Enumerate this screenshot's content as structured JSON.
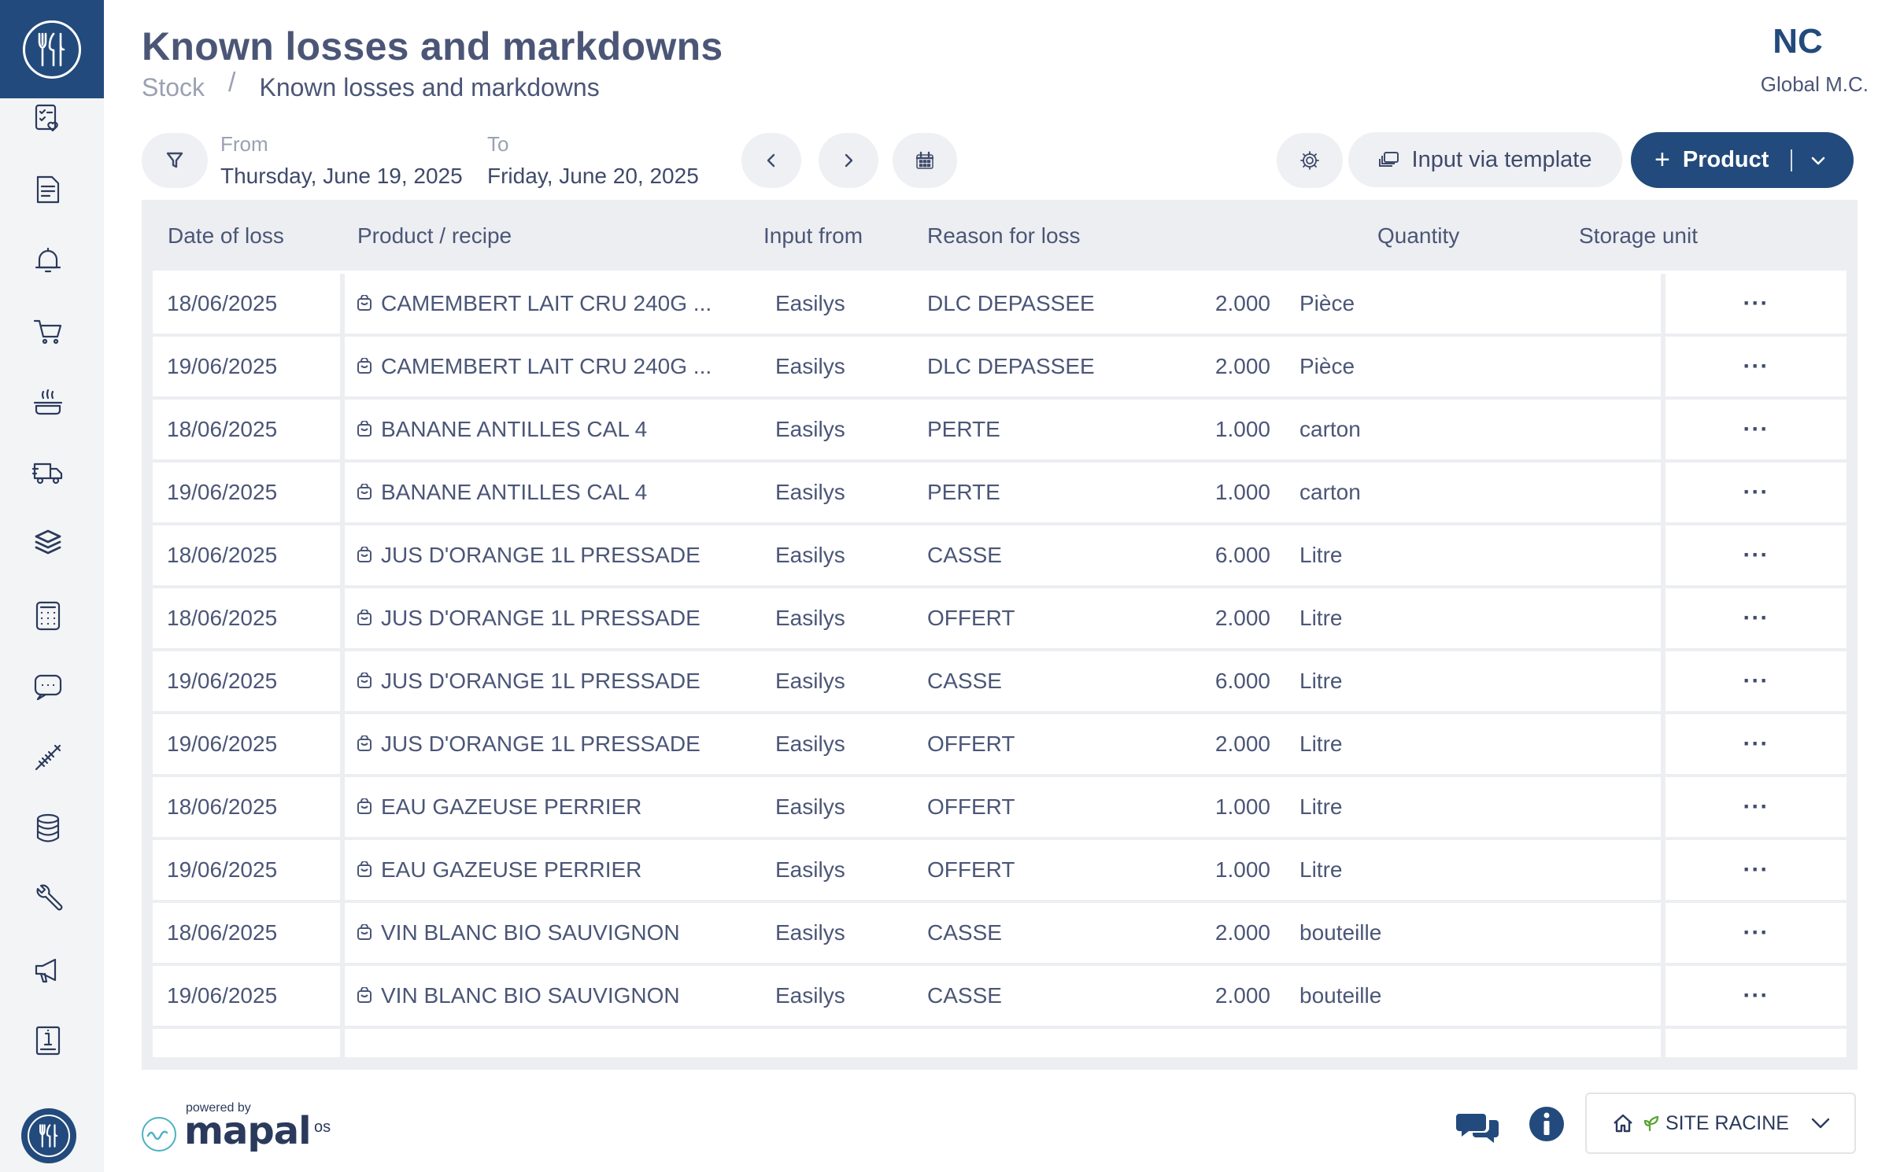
{
  "header": {
    "title": "Known losses and markdowns",
    "breadcrumb": {
      "root": "Stock",
      "separator": "/",
      "current": "Known losses and markdowns"
    },
    "user": {
      "initials": "NC",
      "company": "Global M.C."
    }
  },
  "toolbar": {
    "from_label": "From",
    "from_value": "Thursday, June 19, 2025",
    "to_label": "To",
    "to_value": "Friday, June 20, 2025",
    "template_label": "Input via template",
    "product_plus": "+",
    "product_label": "Product"
  },
  "table": {
    "columns": [
      "Date of loss",
      "Product / recipe",
      "Input from",
      "Reason for loss",
      "Quantity",
      "Storage unit"
    ],
    "row_menu": "···",
    "rows": [
      {
        "date": "18/06/2025",
        "product": "CAMEMBERT LAIT CRU 240G ...",
        "input": "Easilys",
        "reason": "DLC DEPASSEE",
        "qty": "2.000",
        "unit": "Pièce"
      },
      {
        "date": "19/06/2025",
        "product": "CAMEMBERT LAIT CRU 240G ...",
        "input": "Easilys",
        "reason": "DLC DEPASSEE",
        "qty": "2.000",
        "unit": "Pièce"
      },
      {
        "date": "18/06/2025",
        "product": "BANANE ANTILLES CAL 4",
        "input": "Easilys",
        "reason": "PERTE",
        "qty": "1.000",
        "unit": "carton"
      },
      {
        "date": "19/06/2025",
        "product": "BANANE ANTILLES CAL 4",
        "input": "Easilys",
        "reason": "PERTE",
        "qty": "1.000",
        "unit": "carton"
      },
      {
        "date": "18/06/2025",
        "product": "JUS D'ORANGE 1L PRESSADE",
        "input": "Easilys",
        "reason": "CASSE",
        "qty": "6.000",
        "unit": "Litre"
      },
      {
        "date": "18/06/2025",
        "product": "JUS D'ORANGE 1L PRESSADE",
        "input": "Easilys",
        "reason": "OFFERT",
        "qty": "2.000",
        "unit": "Litre"
      },
      {
        "date": "19/06/2025",
        "product": "JUS D'ORANGE 1L PRESSADE",
        "input": "Easilys",
        "reason": "CASSE",
        "qty": "6.000",
        "unit": "Litre"
      },
      {
        "date": "19/06/2025",
        "product": "JUS D'ORANGE 1L PRESSADE",
        "input": "Easilys",
        "reason": "OFFERT",
        "qty": "2.000",
        "unit": "Litre"
      },
      {
        "date": "18/06/2025",
        "product": "EAU GAZEUSE PERRIER",
        "input": "Easilys",
        "reason": "OFFERT",
        "qty": "1.000",
        "unit": "Litre"
      },
      {
        "date": "19/06/2025",
        "product": "EAU GAZEUSE PERRIER",
        "input": "Easilys",
        "reason": "OFFERT",
        "qty": "1.000",
        "unit": "Litre"
      },
      {
        "date": "18/06/2025",
        "product": "VIN BLANC BIO SAUVIGNON",
        "input": "Easilys",
        "reason": "CASSE",
        "qty": "2.000",
        "unit": "bouteille"
      },
      {
        "date": "19/06/2025",
        "product": "VIN BLANC BIO SAUVIGNON",
        "input": "Easilys",
        "reason": "CASSE",
        "qty": "2.000",
        "unit": "bouteille"
      }
    ]
  },
  "footer": {
    "powered_by": "powered by",
    "brand": "mapal",
    "brand_suffix": "os",
    "site": "SITE RACINE"
  },
  "sidebar": {
    "items": [
      "checklist-heart-icon",
      "document-icon",
      "bell-icon",
      "cart-icon",
      "cooking-icon",
      "delivery-truck-icon",
      "stock-layers-icon",
      "calculator-icon",
      "chat-icon",
      "fish-icon",
      "database-icon",
      "wrench-icon",
      "megaphone-icon",
      "info-doc-icon"
    ]
  },
  "colors": {
    "brand": "#234a7c",
    "text": "#4b5677",
    "muted": "#9aa1b2",
    "table_bg": "#eceef1",
    "site_leaf": "#5aa332"
  }
}
